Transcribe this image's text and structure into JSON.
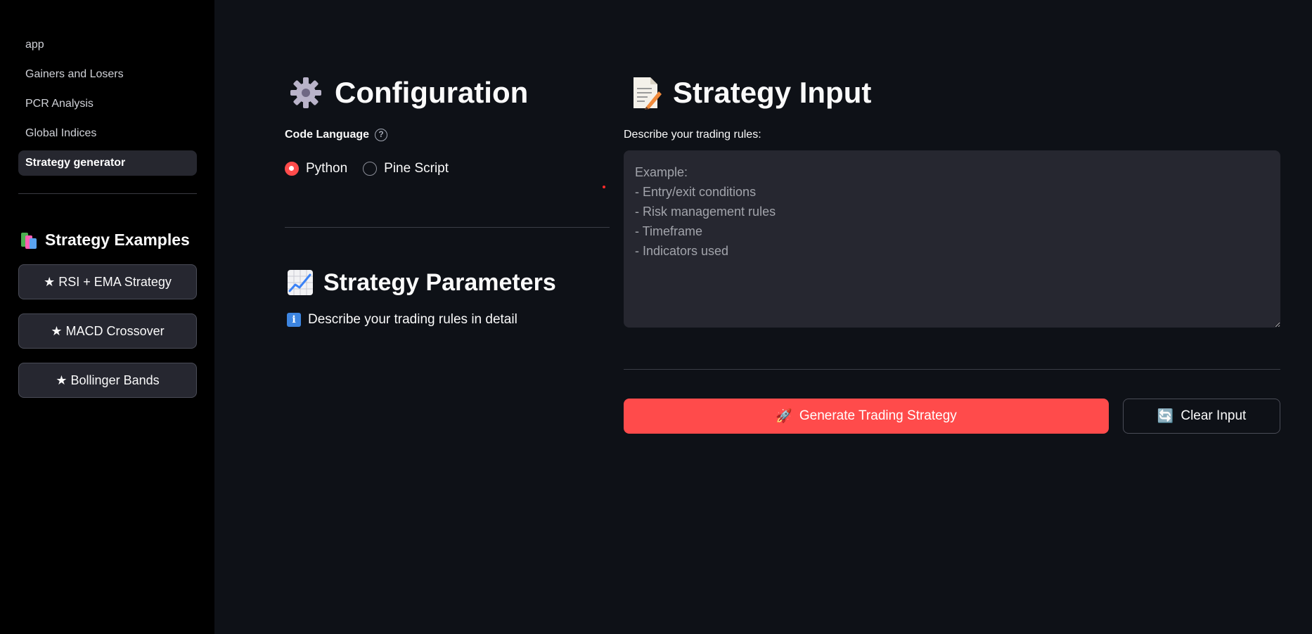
{
  "sidebar": {
    "nav_items": [
      {
        "label": "app"
      },
      {
        "label": "Gainers and Losers"
      },
      {
        "label": "PCR Analysis"
      },
      {
        "label": "Global Indices"
      },
      {
        "label": "Strategy generator"
      }
    ],
    "examples_heading": "Strategy Examples",
    "example_buttons": [
      {
        "label": "★ RSI + EMA Strategy"
      },
      {
        "label": "★ MACD Crossover"
      },
      {
        "label": "★ Bollinger Bands"
      }
    ]
  },
  "configuration": {
    "title": "Configuration",
    "code_language_label": "Code Language",
    "help_icon_glyph": "?",
    "options": [
      {
        "label": "Python",
        "selected": true
      },
      {
        "label": "Pine Script",
        "selected": false
      }
    ]
  },
  "parameters": {
    "title": "Strategy Parameters",
    "info_glyph": "i",
    "info_text": "Describe your trading rules in detail"
  },
  "strategy_input": {
    "title": "Strategy Input",
    "textarea_label": "Describe your trading rules:",
    "placeholder": "Example:\n- Entry/exit conditions\n- Risk management rules\n- Timeframe\n- Indicators used",
    "value": ""
  },
  "actions": {
    "generate_label": "Generate Trading Strategy",
    "clear_label": "Clear Input",
    "generate_emoji": "🚀",
    "clear_emoji": "🔄"
  },
  "colors": {
    "background": "#0e1117",
    "sidebar": "#000000",
    "primary": "#ff4b4b",
    "widget": "#262730"
  }
}
